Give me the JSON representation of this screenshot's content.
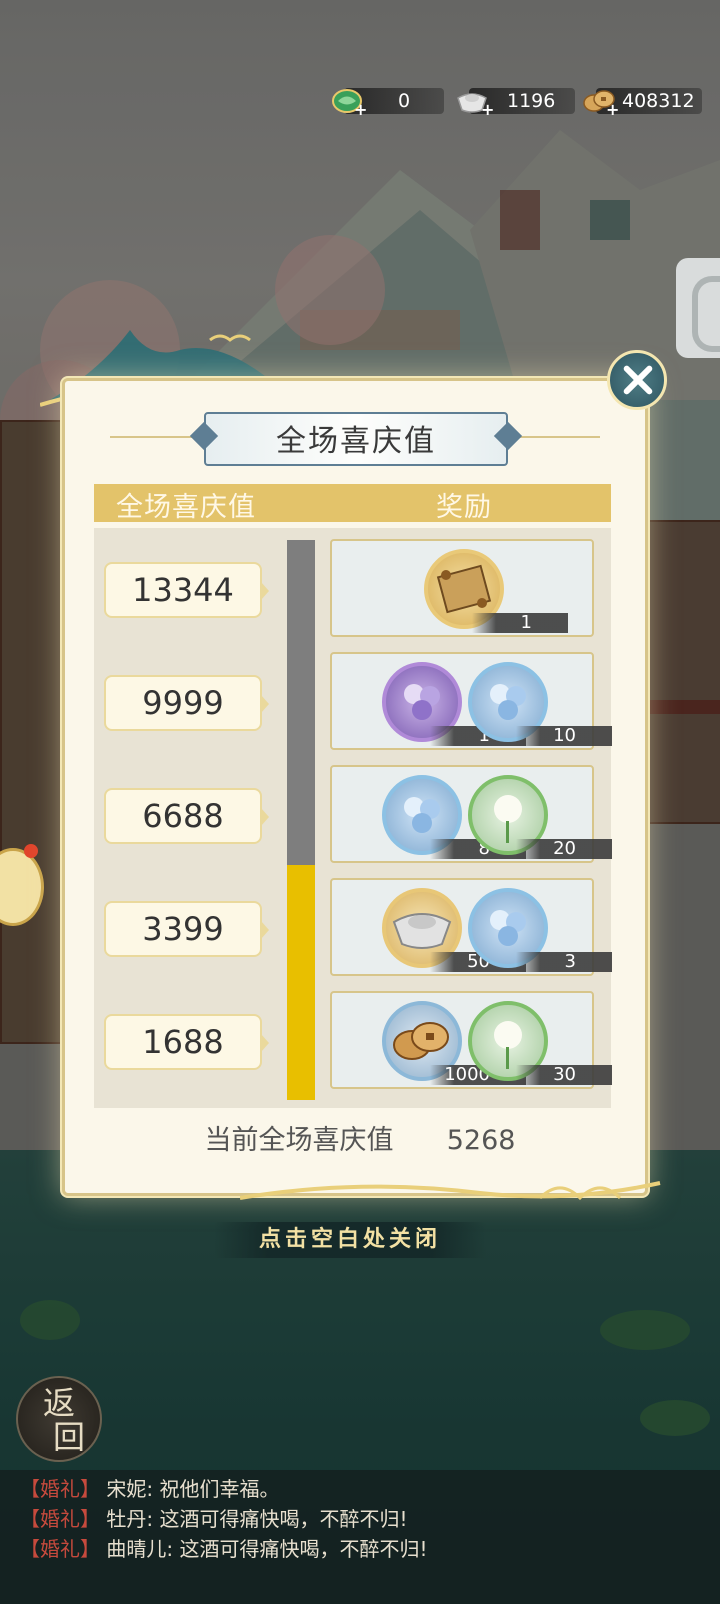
{
  "currency": {
    "jade": "0",
    "silver": "1196",
    "coin": "408312",
    "plus": "+"
  },
  "dialog": {
    "title": "全场喜庆值",
    "col_value": "全场喜庆值",
    "col_reward": "奖励",
    "current_label": "当前全场喜庆值",
    "current_value": "5268",
    "progress_fraction": 0.42,
    "tiers": [
      {
        "value": "13344",
        "rewards": [
          {
            "icon": "scroll-icon",
            "count": "1"
          }
        ]
      },
      {
        "value": "9999",
        "rewards": [
          {
            "icon": "purple-bouquet-icon",
            "count": "1"
          },
          {
            "icon": "blue-bouquet-icon",
            "count": "10"
          }
        ]
      },
      {
        "value": "6688",
        "rewards": [
          {
            "icon": "blue-bouquet-icon",
            "count": "8"
          },
          {
            "icon": "white-flower-icon",
            "count": "20"
          }
        ]
      },
      {
        "value": "3399",
        "rewards": [
          {
            "icon": "silver-ingot-icon",
            "count": "50"
          },
          {
            "icon": "blue-bouquet-icon",
            "count": "3"
          }
        ]
      },
      {
        "value": "1688",
        "rewards": [
          {
            "icon": "copper-coins-icon",
            "count": "1000"
          },
          {
            "icon": "white-flower-icon",
            "count": "30"
          }
        ]
      }
    ]
  },
  "hint": "点击空白处关闭",
  "back_label_1": "返",
  "back_label_2": "回",
  "chat": [
    {
      "tag": "【婚礼】",
      "name": "宋妮:",
      "msg": "祝他们幸福。"
    },
    {
      "tag": "【婚礼】",
      "name": "牡丹:",
      "msg": "这酒可得痛快喝，不醉不归!"
    },
    {
      "tag": "【婚礼】",
      "name": "曲晴儿:",
      "msg": "这酒可得痛快喝，不醉不归!"
    }
  ],
  "colors": {
    "gold": "#e3c36a",
    "progress": "#e8bf00",
    "chat_tag": "#c64a3d"
  }
}
